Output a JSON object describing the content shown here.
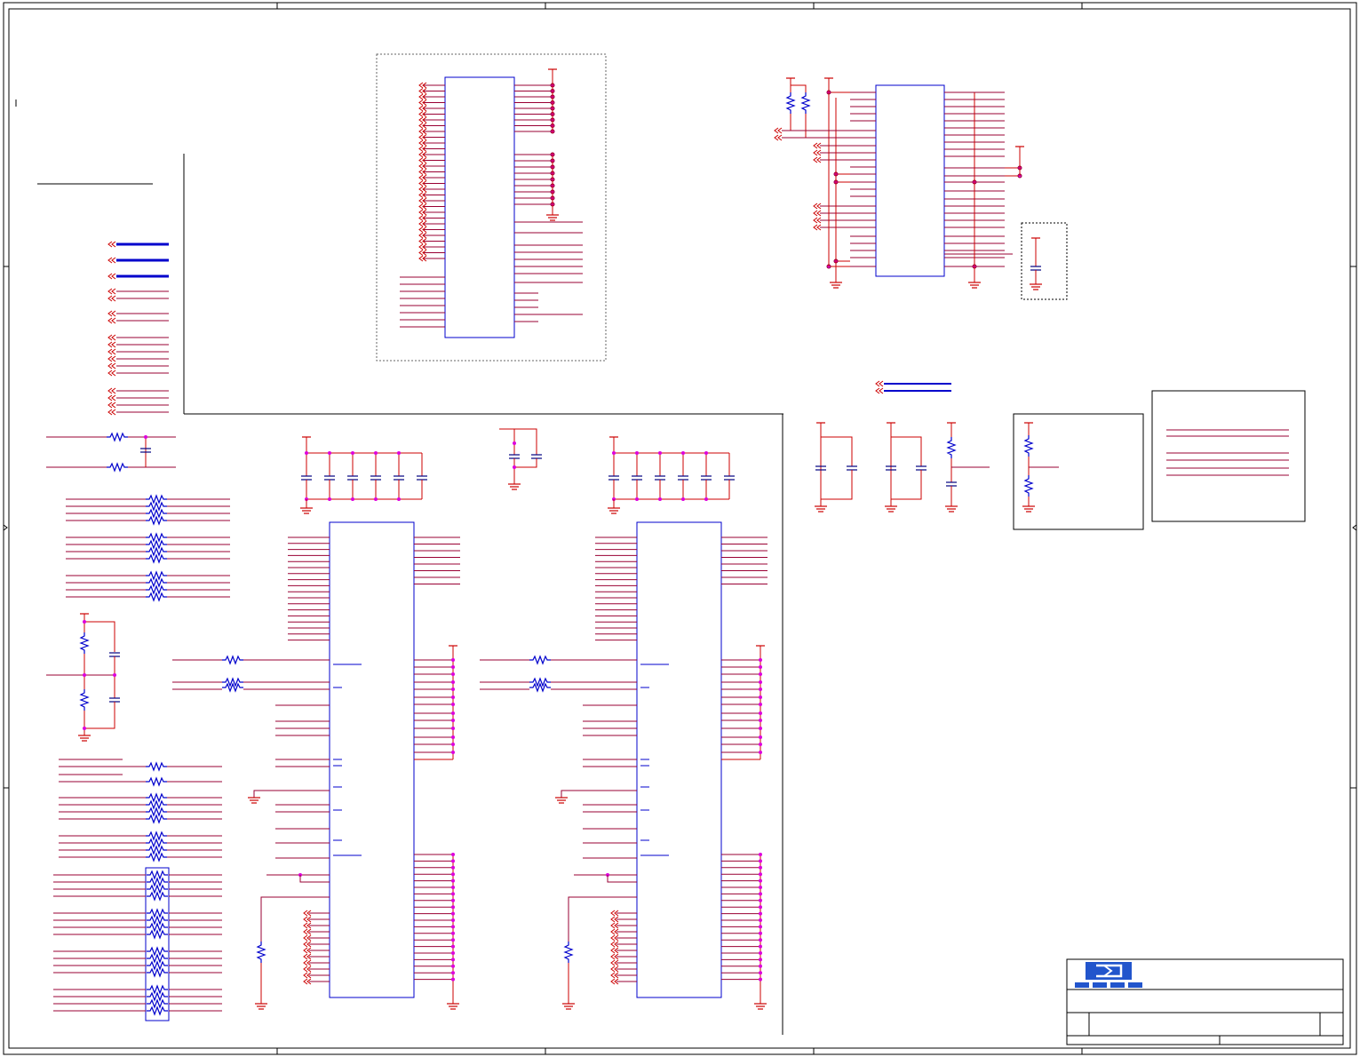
{
  "sheet": {
    "background": "#ffffff",
    "frame_color": "#000000",
    "wire_color": "#cc0000",
    "pin_color": "#990033",
    "bus_color": "#0000cc",
    "part_outline_color": "#0000cc",
    "junction_color": "#dd00dd"
  },
  "symbols": {
    "ground": "ground-icon",
    "power": "power-flag-icon",
    "resistor": "resistor-icon",
    "capacitor": "capacitor-icon",
    "net_port": "net-port-icon",
    "logo": "company-logo-icon"
  },
  "title_block": {
    "logo_lettering": "",
    "title": "",
    "doc_number": "",
    "rev": ""
  }
}
